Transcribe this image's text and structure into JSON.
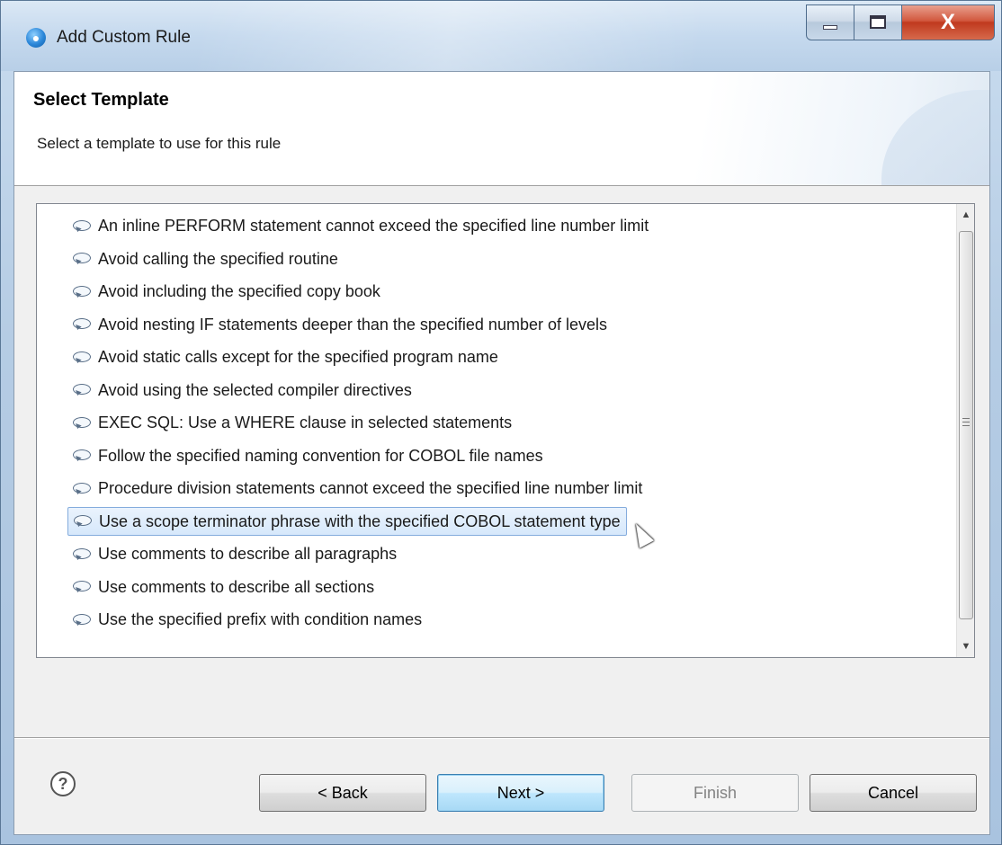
{
  "window": {
    "title": "Add Custom Rule",
    "close_glyph": "X"
  },
  "header": {
    "title": "Select Template",
    "description": "Select a template to use for this rule"
  },
  "list": {
    "icon": "comment-bubble-icon",
    "selected_index": 9,
    "items": [
      "An inline PERFORM statement cannot exceed the specified line number limit",
      "Avoid calling the specified routine",
      "Avoid including the specified copy book",
      "Avoid nesting IF statements deeper than the specified number of levels",
      "Avoid static calls except for the specified program name",
      "Avoid using the selected compiler directives",
      "EXEC SQL: Use a WHERE clause in selected statements",
      "Follow the specified naming convention for COBOL file names",
      "Procedure division statements cannot exceed the specified line number limit",
      "Use a scope terminator phrase with the specified COBOL statement type",
      "Use comments to describe all paragraphs",
      "Use comments to describe all sections",
      "Use the specified prefix with condition names"
    ]
  },
  "footer": {
    "help_glyph": "?",
    "back_label": "< Back",
    "next_label": "Next >",
    "finish_label": "Finish",
    "cancel_label": "Cancel"
  },
  "colors": {
    "selection_bg": "#d6e8fb",
    "selection_border": "#84acdd",
    "close_button": "#c0391e"
  }
}
